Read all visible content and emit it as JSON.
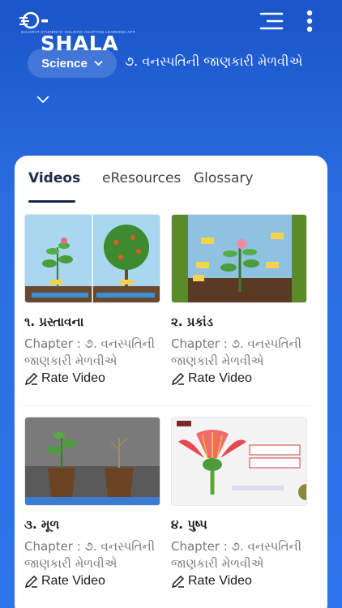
{
  "header": {
    "logo_text": "-SHALA",
    "logo_tagline": "GUJARAT STUDENTS' HOLISTIC ADAPTIVE LEARNING APP"
  },
  "breadcrumb": {
    "subject": "Science",
    "chapter": "૭. વનસ્પતિની જાણકારી મેળવીએ"
  },
  "tabs": [
    {
      "label": "Videos",
      "active": true
    },
    {
      "label": "eResources",
      "active": false
    },
    {
      "label": "Glossary",
      "active": false
    }
  ],
  "videos": [
    {
      "title": "૧. પ્રસ્તાવના",
      "chapter": "Chapter : ૭. વનસ્પતિની જાણકારી મેળવીએ",
      "rate_label": "Rate Video"
    },
    {
      "title": "૨. પ્રકાંડ",
      "chapter": "Chapter : ૭. વનસ્પતિની જાણકારી મેળવીએ",
      "rate_label": "Rate Video"
    },
    {
      "title": "૩. મૂળ",
      "chapter": "Chapter : ૭. વનસ્પતિની જાણકારી મેળવીએ",
      "rate_label": "Rate Video"
    },
    {
      "title": "૪. પુષ્પ",
      "chapter": "Chapter : ૭. વનસ્પતિની જાણકારી મેળવીએ",
      "rate_label": "Rate Video"
    }
  ],
  "thumb_labels": {
    "v2": [
      "ફળ",
      "પુષ્પ",
      "પર્ણ",
      "શાખા",
      "મૂળ"
    ]
  },
  "icons": [
    "logo-mark-icon",
    "menu-icon",
    "more-vertical-icon",
    "chevron-down-icon",
    "pencil-icon"
  ],
  "colors": {
    "primary": "#2b6ee3",
    "text_dark": "#1c2b4a"
  }
}
